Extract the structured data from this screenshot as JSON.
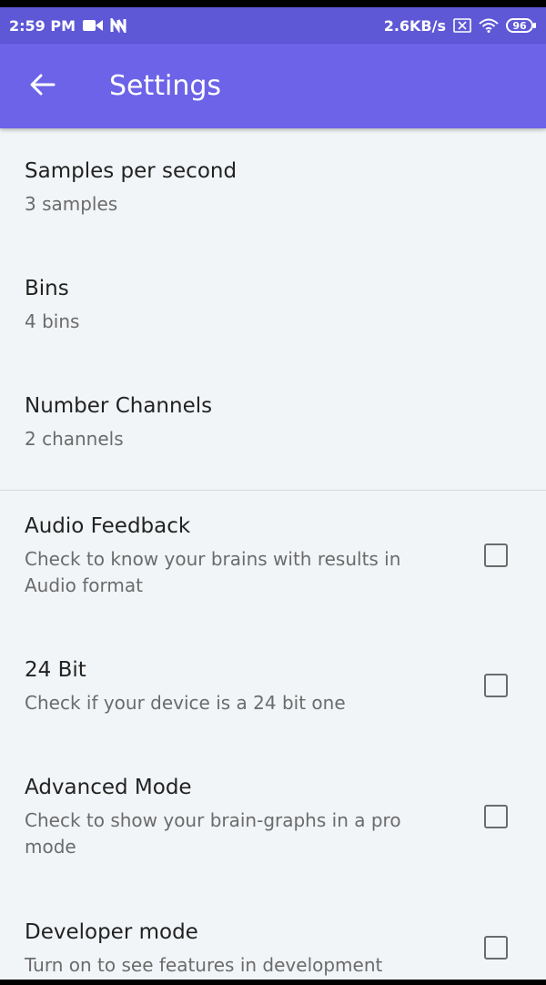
{
  "status_bar": {
    "time": "2:59 PM",
    "left_icons": [
      "video-camera-icon",
      "notification-n-icon"
    ],
    "network_speed": "2.6KB/s",
    "right_icons": [
      "sim-off-icon",
      "wifi-icon",
      "battery-icon"
    ],
    "battery_level": "96"
  },
  "app_bar": {
    "back_icon": "arrow-left-icon",
    "title": "Settings",
    "color": "#6c63e8"
  },
  "preferences": [
    {
      "title": "Samples per second",
      "summary": "3 samples"
    },
    {
      "title": "Bins",
      "summary": "4 bins"
    },
    {
      "title": "Number Channels",
      "summary": "2 channels"
    }
  ],
  "toggles": [
    {
      "title": "Audio Feedback",
      "summary": "Check to know your brains with results in Audio format",
      "checked": false
    },
    {
      "title": "24 Bit",
      "summary": "Check if your device is a 24 bit one",
      "checked": false
    },
    {
      "title": "Advanced Mode",
      "summary": "Check to show your brain-graphs in a pro mode",
      "checked": false
    },
    {
      "title": "Developer mode",
      "summary": "Turn on to see features in development",
      "checked": false
    }
  ]
}
